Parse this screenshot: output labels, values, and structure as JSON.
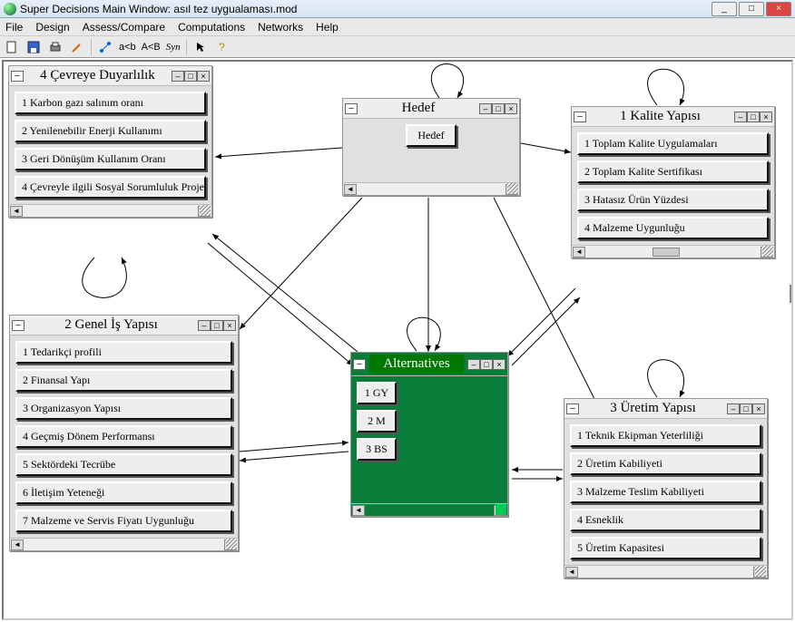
{
  "window": {
    "title": "Super Decisions Main Window: asıl tez uygualaması.mod",
    "minimize_label": "_",
    "maximize_label": "□",
    "close_label": "×"
  },
  "menu": {
    "file": "File",
    "design": "Design",
    "assess": "Assess/Compare",
    "computations": "Computations",
    "networks": "Networks",
    "help": "Help"
  },
  "toolbar": {
    "acb_small": "a<b",
    "acb_large": "A<B",
    "syn": "Syn"
  },
  "clusters": {
    "cevreye": {
      "title": "4 Çevreye Duyarlılık",
      "items": [
        "1 Karbon gazı salınım oranı",
        "2 Yenilenebilir Enerji Kullanımı",
        "3 Geri Dönüşüm Kullanım Oranı",
        "4 Çevreyle ilgili Sosyal Sorumluluk Proje"
      ]
    },
    "hedef": {
      "title": "Hedef",
      "items": [
        "Hedef"
      ]
    },
    "kalite": {
      "title": "1 Kalite Yapısı",
      "items": [
        "1 Toplam Kalite Uygulamaları",
        "2 Toplam Kalite Sertifikası",
        "3 Hatasız Ürün Yüzdesi",
        "4 Malzeme Uygunluğu"
      ]
    },
    "genelis": {
      "title": "2 Genel İş Yapısı",
      "items": [
        "1 Tedarikçi profili",
        "2 Finansal Yapı",
        "3 Organizasyon Yapısı",
        "4 Geçmiş Dönem Performansı",
        "5 Sektördeki Tecrübe",
        "6 İletişim Yeteneği",
        "7 Malzeme ve Servis Fiyatı Uygunluğu"
      ]
    },
    "alternatives": {
      "title": "Alternatives",
      "items": [
        "1 GY",
        "2 M",
        "3 BS"
      ]
    },
    "uretim": {
      "title": "3 Üretim Yapısı",
      "items": [
        "1 Teknik Ekipman Yeterliliği",
        "2 Üretim Kabiliyeti",
        "3 Malzeme Teslim Kabiliyeti",
        "4 Esneklik",
        "5 Üretim Kapasitesi"
      ]
    }
  }
}
